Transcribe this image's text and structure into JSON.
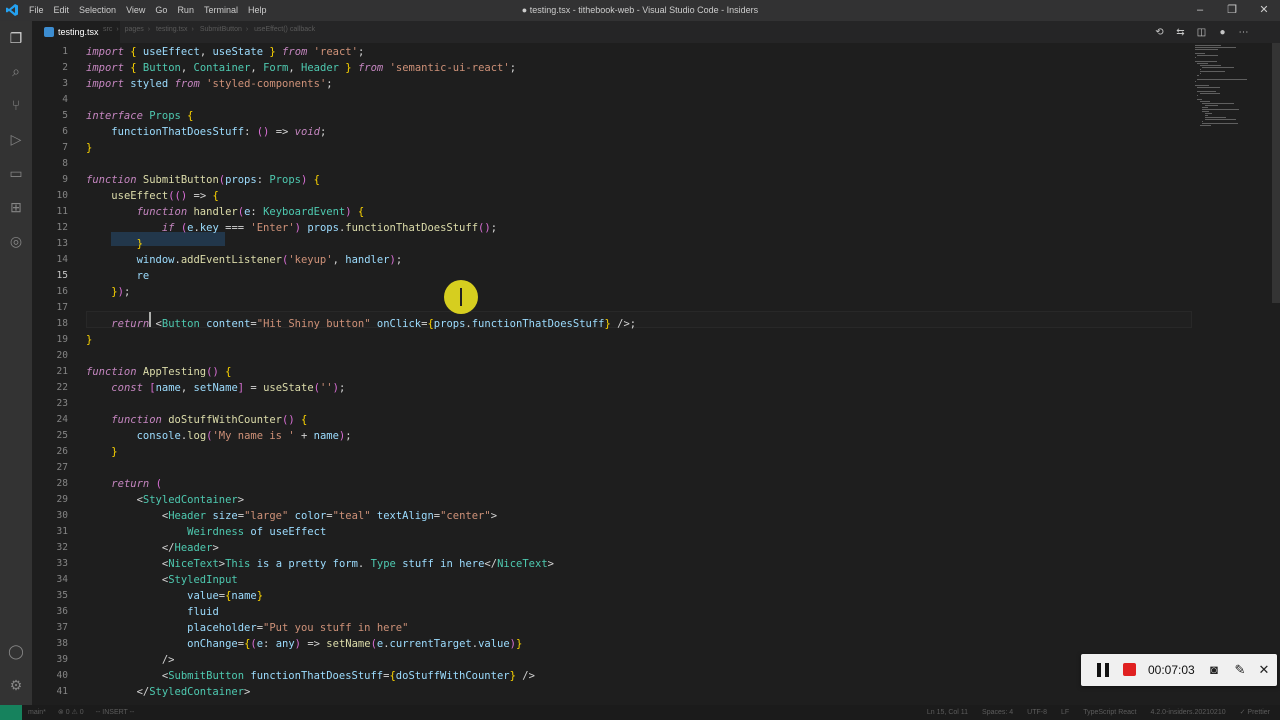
{
  "menu": [
    "File",
    "Edit",
    "Selection",
    "View",
    "Go",
    "Run",
    "Terminal",
    "Help"
  ],
  "window_title": "● testing.tsx - tithebook-web - Visual Studio Code - Insiders",
  "tab": {
    "label": "testing.tsx"
  },
  "breadcrumb": [
    "src",
    "pages",
    "testing.tsx",
    "SubmitButton",
    "useEffect() callback"
  ],
  "code_lines": [
    {
      "n": "1",
      "text": "import { useEffect, useState } from 'react';"
    },
    {
      "n": "2",
      "text": "import { Button, Container, Form, Header } from 'semantic-ui-react';"
    },
    {
      "n": "3",
      "text": "import styled from 'styled-components';"
    },
    {
      "n": "4",
      "text": ""
    },
    {
      "n": "5",
      "text": "interface Props {"
    },
    {
      "n": "6",
      "text": "    functionThatDoesStuff: () => void;"
    },
    {
      "n": "7",
      "text": "}"
    },
    {
      "n": "8",
      "text": ""
    },
    {
      "n": "9",
      "text": "function SubmitButton(props: Props) {"
    },
    {
      "n": "10",
      "text": "    useEffect(() => {"
    },
    {
      "n": "11",
      "text": "        function handler(e: KeyboardEvent) {"
    },
    {
      "n": "12",
      "text": "            if (e.key === 'Enter') props.functionThatDoesStuff();"
    },
    {
      "n": "13",
      "text": "        }"
    },
    {
      "n": "14",
      "text": "        window.addEventListener('keyup', handler);"
    },
    {
      "n": "15",
      "text": "        re"
    },
    {
      "n": "16",
      "text": "    });"
    },
    {
      "n": "17",
      "text": ""
    },
    {
      "n": "18",
      "text": "    return <Button content=\"Hit Shiny button\" onClick={props.functionThatDoesStuff} />;"
    },
    {
      "n": "19",
      "text": "}"
    },
    {
      "n": "20",
      "text": ""
    },
    {
      "n": "21",
      "text": "function AppTesting() {"
    },
    {
      "n": "22",
      "text": "    const [name, setName] = useState('');"
    },
    {
      "n": "23",
      "text": ""
    },
    {
      "n": "24",
      "text": "    function doStuffWithCounter() {"
    },
    {
      "n": "25",
      "text": "        console.log('My name is ' + name);"
    },
    {
      "n": "26",
      "text": "    }"
    },
    {
      "n": "27",
      "text": ""
    },
    {
      "n": "28",
      "text": "    return ("
    },
    {
      "n": "29",
      "text": "        <StyledContainer>"
    },
    {
      "n": "30",
      "text": "            <Header size=\"large\" color=\"teal\" textAlign=\"center\">"
    },
    {
      "n": "31",
      "text": "                Weirdness of useEffect"
    },
    {
      "n": "32",
      "text": "            </Header>"
    },
    {
      "n": "33",
      "text": "            <NiceText>This is a pretty form. Type stuff in here</NiceText>"
    },
    {
      "n": "34",
      "text": "            <StyledInput"
    },
    {
      "n": "35",
      "text": "                value={name}"
    },
    {
      "n": "36",
      "text": "                fluid"
    },
    {
      "n": "37",
      "text": "                placeholder=\"Put you stuff in here\""
    },
    {
      "n": "38",
      "text": "                onChange={(e: any) => setName(e.currentTarget.value)}"
    },
    {
      "n": "39",
      "text": "            />"
    },
    {
      "n": "40",
      "text": "            <SubmitButton functionThatDoesStuff={doStuffWithCounter} />"
    },
    {
      "n": "41",
      "text": "        </StyledContainer>"
    }
  ],
  "status": {
    "branch": "main*",
    "errors": "⊗ 0 ⚠ 0",
    "mode": "-- INSERT --",
    "position": "Ln 15, Col 11",
    "spaces": "Spaces: 4",
    "encoding": "UTF-8",
    "eol": "LF",
    "language": "TypeScript React",
    "version": "4.2.0-insiders.20210210",
    "formatter": "✓ Prettier"
  },
  "recorder": {
    "time": "00:07:03"
  }
}
